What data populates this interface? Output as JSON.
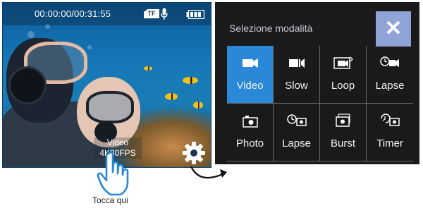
{
  "camera_view": {
    "timecode": "00:00:00/00:31:55",
    "storage_badge": "TF",
    "icons": [
      "tf-card-icon",
      "microphone-icon",
      "battery-icon",
      "gear-icon"
    ],
    "current_mode_line1": "Video",
    "current_mode_line2": "4K30FPS"
  },
  "hint": {
    "caption": "Tocca qui",
    "icon": "tap-hand-icon",
    "color": "#2a88d8"
  },
  "mode_menu": {
    "title": "Selezione modalità",
    "close_icon": "close-icon",
    "close_bg": "#8fa3d6",
    "selected_color": "#2a88d8",
    "modes": [
      {
        "label": "Video",
        "icon": "video-camera-icon",
        "selected": true
      },
      {
        "label": "Slow",
        "icon": "slow-motion-icon",
        "selected": false
      },
      {
        "label": "Loop",
        "icon": "loop-recording-icon",
        "selected": false
      },
      {
        "label": "Lapse",
        "icon": "video-lapse-icon",
        "selected": false
      },
      {
        "label": "Photo",
        "icon": "photo-camera-icon",
        "selected": false
      },
      {
        "label": "Lapse",
        "icon": "photo-lapse-icon",
        "selected": false
      },
      {
        "label": "Burst",
        "icon": "burst-photo-icon",
        "selected": false
      },
      {
        "label": "Timer",
        "icon": "self-timer-icon",
        "selected": false
      }
    ]
  }
}
